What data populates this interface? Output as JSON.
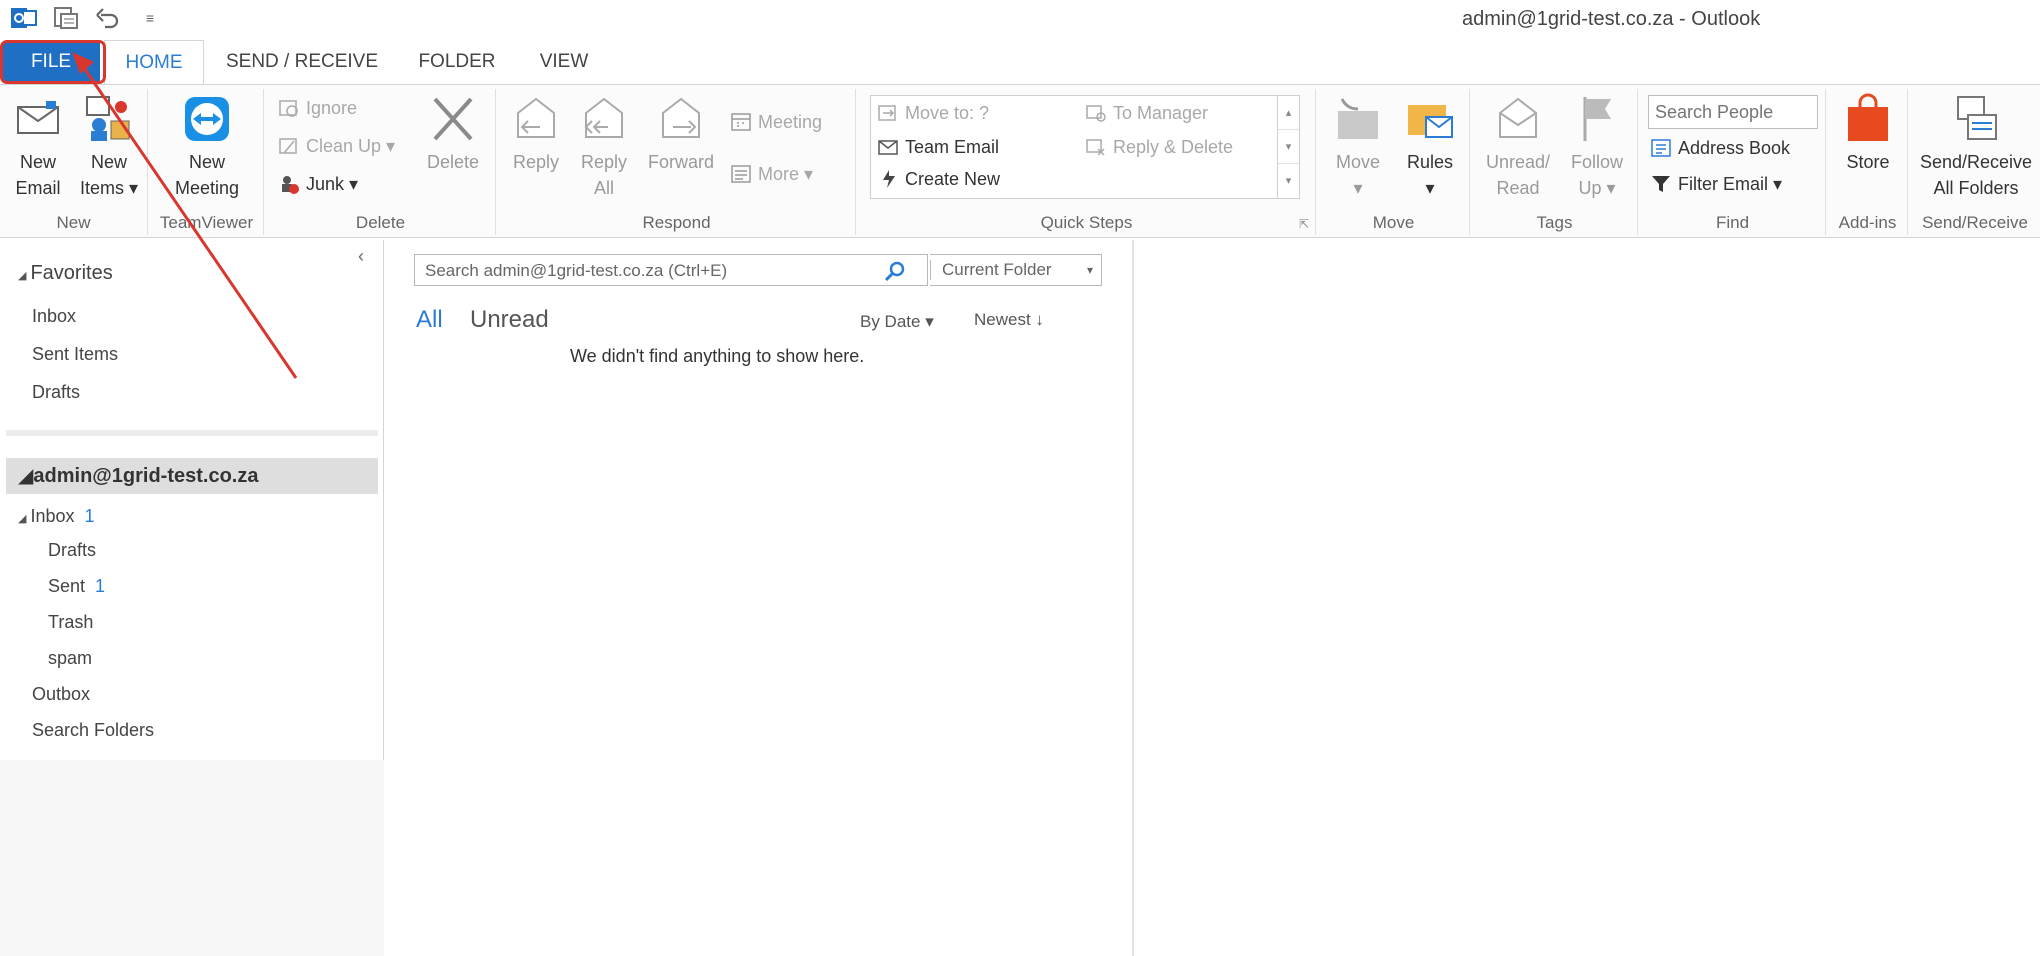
{
  "window": {
    "title": "admin@1grid-test.co.za - Outlook"
  },
  "quick_access": [
    {
      "icon": "outlook-icon"
    },
    {
      "icon": "send-receive-all-icon"
    },
    {
      "icon": "undo-icon"
    },
    {
      "icon": "customize-qat-icon",
      "glyph": "≡"
    }
  ],
  "tabs": {
    "file": "FILE",
    "home": "HOME",
    "send_receive": "SEND / RECEIVE",
    "folder": "FOLDER",
    "view": "VIEW"
  },
  "ribbon": {
    "new": {
      "label": "New",
      "new_email": "New Email",
      "new_email_l1": "New",
      "new_email_l2": "Email",
      "new_items_l1": "New",
      "new_items_l2": "Items ▾"
    },
    "teamviewer": {
      "label": "TeamViewer",
      "new_meeting_l1": "New",
      "new_meeting_l2": "Meeting"
    },
    "delete": {
      "label": "Delete",
      "ignore": "Ignore",
      "clean_up": "Clean Up ▾",
      "junk": "Junk ▾",
      "delete": "Delete"
    },
    "respond": {
      "label": "Respond",
      "reply": "Reply",
      "reply_all_l1": "Reply",
      "reply_all_l2": "All",
      "forward": "Forward",
      "meeting": "Meeting",
      "more": "More ▾"
    },
    "quick_steps": {
      "label": "Quick Steps",
      "move_to": "Move to: ?",
      "team_email": "Team Email",
      "create_new": "Create New",
      "to_manager": "To Manager",
      "reply_delete": "Reply & Delete"
    },
    "move": {
      "label": "Move",
      "move": "Move",
      "move_arrow": "▾",
      "rules": "Rules",
      "rules_arrow": "▾"
    },
    "tags": {
      "label": "Tags",
      "unread_l1": "Unread/",
      "unread_l2": "Read",
      "follow_l1": "Follow",
      "follow_l2": "Up ▾"
    },
    "find": {
      "label": "Find",
      "search_people_placeholder": "Search People",
      "address_book": "Address Book",
      "filter_email": "Filter Email ▾"
    },
    "addins": {
      "label": "Add-ins",
      "store": "Store"
    },
    "send_receive": {
      "label": "Send/Receive",
      "all_l1": "Send/Receive",
      "all_l2": "All Folders"
    }
  },
  "nav": {
    "collapse_glyph": "‹",
    "favorites_label": "Favorites",
    "favorites": [
      "Inbox",
      "Sent Items",
      "Drafts"
    ],
    "account": "admin@1grid-test.co.za",
    "inbox": {
      "label": "Inbox",
      "count": "1"
    },
    "drafts": "Drafts",
    "sent": {
      "label": "Sent",
      "count": "1"
    },
    "trash": "Trash",
    "spam": "spam",
    "outbox": "Outbox",
    "search_folders": "Search Folders"
  },
  "list": {
    "search_placeholder": "Search admin@1grid-test.co.za (Ctrl+E)",
    "scope": "Current Folder",
    "scope_arrow": "▾",
    "filter_all": "All",
    "filter_unread": "Unread",
    "sort_by": "By Date ▾",
    "sort_order": "Newest ↓",
    "empty_message": "We didn't find anything to show here."
  },
  "colors": {
    "accent": "#2b7cd3",
    "file_tab": "#1f6fc5",
    "annotation": "#d9362d"
  }
}
